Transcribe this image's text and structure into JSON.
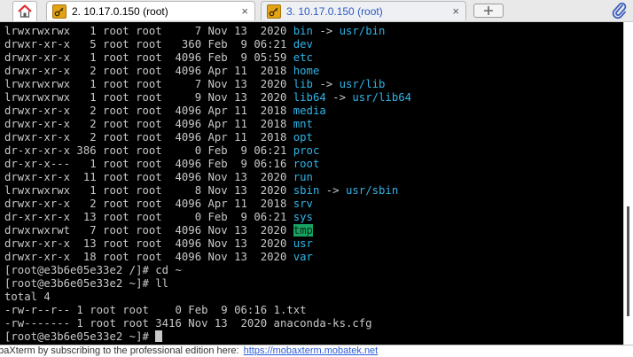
{
  "tabs": [
    {
      "label": "2. 10.17.0.150 (root)",
      "close": "×",
      "icon": "session-key-icon",
      "active": true
    },
    {
      "label": "3. 10.17.0.150 (root)",
      "close": "×",
      "icon": "session-key-icon",
      "active": false
    }
  ],
  "colors": {
    "terminal_bg": "#000000",
    "terminal_fg": "#c8c8c8",
    "dir_blue": "#2fb4e6",
    "highlight_green": "#17a361",
    "tab_link": "#2b59c3"
  },
  "terminal": {
    "lines": [
      {
        "prefix": "lrwxrwxrwx   1 root root     7 Nov 13  2020 ",
        "name": "bin",
        "link": "usr/bin"
      },
      {
        "prefix": "drwxr-xr-x   5 root root   360 Feb  9 06:21 ",
        "name": "dev"
      },
      {
        "prefix": "drwxr-xr-x   1 root root  4096 Feb  9 05:59 ",
        "name": "etc"
      },
      {
        "prefix": "drwxr-xr-x   2 root root  4096 Apr 11  2018 ",
        "name": "home"
      },
      {
        "prefix": "lrwxrwxrwx   1 root root     7 Nov 13  2020 ",
        "name": "lib",
        "link": "usr/lib"
      },
      {
        "prefix": "lrwxrwxrwx   1 root root     9 Nov 13  2020 ",
        "name": "lib64",
        "link": "usr/lib64"
      },
      {
        "prefix": "drwxr-xr-x   2 root root  4096 Apr 11  2018 ",
        "name": "media"
      },
      {
        "prefix": "drwxr-xr-x   2 root root  4096 Apr 11  2018 ",
        "name": "mnt"
      },
      {
        "prefix": "drwxr-xr-x   2 root root  4096 Apr 11  2018 ",
        "name": "opt"
      },
      {
        "prefix": "dr-xr-xr-x 386 root root     0 Feb  9 06:21 ",
        "name": "proc"
      },
      {
        "prefix": "dr-xr-x---   1 root root  4096 Feb  9 06:16 ",
        "name": "root"
      },
      {
        "prefix": "drwxr-xr-x  11 root root  4096 Nov 13  2020 ",
        "name": "run"
      },
      {
        "prefix": "lrwxrwxrwx   1 root root     8 Nov 13  2020 ",
        "name": "sbin",
        "link": "usr/sbin"
      },
      {
        "prefix": "drwxr-xr-x   2 root root  4096 Apr 11  2018 ",
        "name": "srv"
      },
      {
        "prefix": "dr-xr-xr-x  13 root root     0 Feb  9 06:21 ",
        "name": "sys"
      },
      {
        "prefix": "drwxrwxrwt   7 root root  4096 Nov 13  2020 ",
        "name": "tmp",
        "highlight": true
      },
      {
        "prefix": "drwxr-xr-x  13 root root  4096 Nov 13  2020 ",
        "name": "usr"
      },
      {
        "prefix": "drwxr-xr-x  18 root root  4096 Nov 13  2020 ",
        "name": "var"
      },
      {
        "text": "[root@e3b6e05e33e2 /]# cd ~"
      },
      {
        "text": "[root@e3b6e05e33e2 ~]# ll"
      },
      {
        "text": "total 4"
      },
      {
        "text": "-rw-r--r-- 1 root root    0 Feb  9 06:16 1.txt"
      },
      {
        "text": "-rw------- 1 root root 3416 Nov 13  2020 anaconda-ks.cfg"
      },
      {
        "text": "[root@e3b6e05e33e2 ~]# ",
        "cursor": true
      }
    ],
    "link_arrow": " -> "
  },
  "status": {
    "text": "obaXterm by subscribing to the professional edition here:",
    "link": "https://mobaxterm.mobatek.net"
  }
}
